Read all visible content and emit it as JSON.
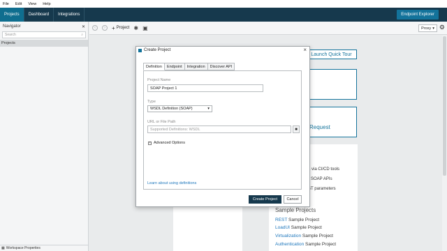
{
  "menu": [
    "File",
    "Edit",
    "View",
    "Help"
  ],
  "nav_tabs": [
    "Projects",
    "Dashboard",
    "Integrations"
  ],
  "endpoint_explorer": "Endpoint Explorer",
  "navigator": {
    "title": "Navigator",
    "search_placeholder": "Search",
    "projects_label": "Projects",
    "footer": "Workspace Properties"
  },
  "toolbar": {
    "project_label": "Project",
    "proxy": "Proxy"
  },
  "workspace": {
    "launch": "Launch Quick Tour",
    "card_a": "st",
    "card_b": "Request",
    "frag1": "a via CI/CD tools",
    "frag2": "SOAP APIs",
    "frag3": "ST parameters",
    "sample_title": "Sample Projects",
    "samples": [
      {
        "link": "REST",
        "rest": " Sample Project"
      },
      {
        "link": "LoadUI",
        "rest": " Sample Project"
      },
      {
        "link": "Virtualization",
        "rest": " Sample Project"
      },
      {
        "link": "Authentication",
        "rest": " Sample Project"
      }
    ]
  },
  "dialog": {
    "title": "Create Project",
    "tabs": [
      "Definition",
      "Endpoint",
      "Integration",
      "Discover API"
    ],
    "project_name_label": "Project Name",
    "project_name_value": "SOAP Project 1",
    "type_label": "Type",
    "type_value": "WSDL Definition (SOAP)",
    "url_label": "URL or File Path",
    "url_placeholder": "Supported Definitions: WSDL",
    "advanced": "Advanced Options",
    "learn": "Learn about using definitions",
    "create_btn": "Create Project",
    "cancel_btn": "Cancel"
  },
  "colors": {
    "navbar": "#16394d",
    "accent": "#13739b",
    "link": "#1b75bb"
  }
}
